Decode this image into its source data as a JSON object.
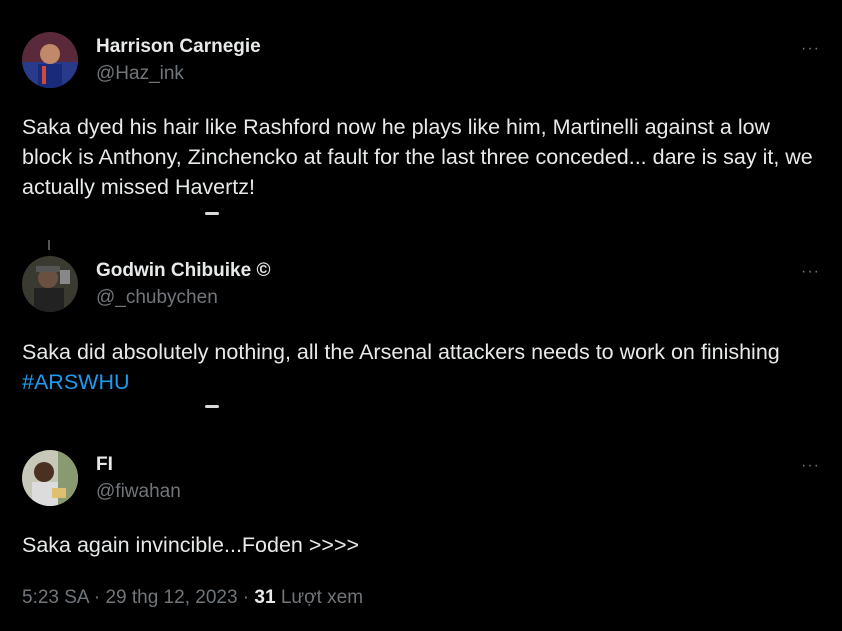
{
  "tweets": [
    {
      "name": "Harrison Carnegie",
      "handle": "@Haz_ink",
      "text": "Saka dyed his hair like Rashford now he plays like him, Martinelli against a low block is Anthony, Zinchencko at fault for the last three conceded... dare is say it, we actually missed Havertz!",
      "more": "···",
      "avatar_icon": "profile-photo-icon"
    },
    {
      "name": "Godwin Chibuike ©",
      "handle": "@_chubychen",
      "text_prefix": "Saka did absolutely nothing, all the Arsenal attackers needs to work on finishing ",
      "hashtag": "#ARSWHU",
      "more": "···",
      "avatar_icon": "profile-photo-icon"
    },
    {
      "name": "FI",
      "handle": "@fiwahan",
      "text": "Saka again invincible...Foden >>>>",
      "more": "···",
      "avatar_icon": "profile-photo-icon",
      "meta": {
        "time": "5:23 SA",
        "sep1": " · ",
        "date": "29 thg 12, 2023",
        "sep2": " · ",
        "views_count": "31",
        "views_label": " Lượt xem"
      }
    }
  ],
  "colors": {
    "background": "#000000",
    "text": "#e7e9ea",
    "muted": "#71767b",
    "hashtag": "#1d9bf0"
  }
}
